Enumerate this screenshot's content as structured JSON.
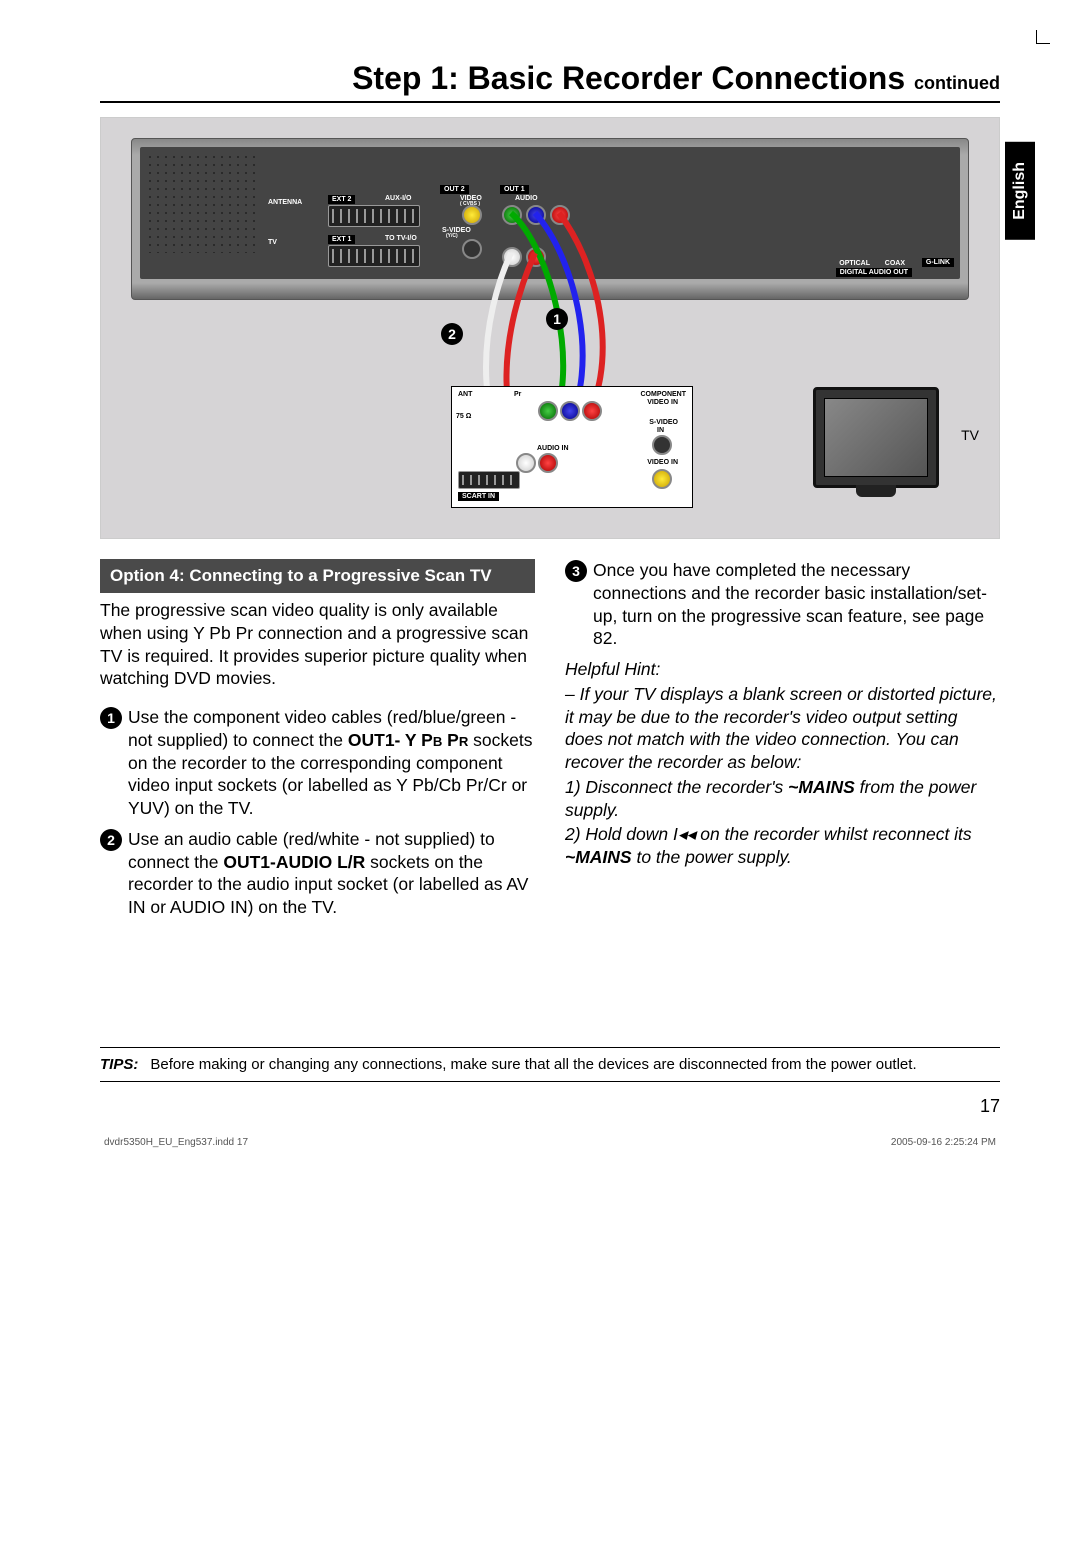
{
  "title_main": "Step 1: Basic Recorder Connections ",
  "title_cont": "continued",
  "lang_tab": "English",
  "diagram": {
    "tv_label": "TV",
    "callout_1": "1",
    "callout_2": "2",
    "recorder_labels": {
      "antenna": "ANTENNA",
      "tv": "TV",
      "ext2": "EXT 2",
      "ext1": "EXT 1",
      "aux": "AUX-I/O",
      "totv": "TO TV-I/O",
      "out2": "OUT 2",
      "out1": "OUT 1",
      "video": "VIDEO",
      "cvbs": "( CVBS )",
      "svideo": "S-VIDEO",
      "yc": "(Y/C)",
      "audio": "AUDIO",
      "optical": "OPTICAL",
      "coax": "COAX",
      "dao": "DIGITAL AUDIO OUT",
      "glink": "G-LINK"
    },
    "tv_labels": {
      "ant": "ANT",
      "75ohm": "75 Ω",
      "pr": "Pr",
      "component": "COMPONENT",
      "videoin": "VIDEO IN",
      "svideo": "S-VIDEO",
      "in": "IN",
      "audioin": "AUDIO IN",
      "videoin2": "VIDEO IN",
      "scartin": "SCART IN"
    }
  },
  "option_heading": "Option 4: Connecting to a Progressive Scan TV",
  "intro_para": "The progressive scan video quality is only available when using Y Pb Pr connection and a progressive scan TV is required. It provides superior picture quality when watching DVD movies.",
  "step1": {
    "num": "1",
    "pre": "Use the component video cables (red/blue/green - not supplied) to connect the ",
    "bold1": "OUT1- Y P",
    "sc1": "B",
    "bold2": " P",
    "sc2": "R",
    "post": " sockets on the recorder to the corresponding component video input sockets (or labelled as Y Pb/Cb Pr/Cr or YUV) on the TV."
  },
  "step2": {
    "num": "2",
    "pre": "Use an audio cable (red/white - not supplied) to connect the ",
    "bold": "OUT1-AUDIO L/R",
    "post": " sockets on the recorder to the audio input socket (or labelled as AV IN or AUDIO IN) on the TV."
  },
  "step3": {
    "num": "3",
    "text": "Once you have completed the necessary connections and the recorder basic installation/set-up, turn on the progressive scan feature, see page 82."
  },
  "hint_label": "Helpful Hint:",
  "hint1": "– If your TV displays a blank screen or distorted picture, it may be due to the recorder's video output setting does not match with the video connection. You can recover the recorder as below:",
  "hint2_pre": "1) Disconnect the recorder's ",
  "hint2_bold": "~MAINS",
  "hint2_post": " from the power supply.",
  "hint3_pre": "2) Hold down ",
  "hint3_icon": "I◂◂",
  "hint3_mid": " on the recorder whilst reconnect its ",
  "hint3_bold": "~MAINS",
  "hint3_post": " to the power supply.",
  "tips_label": "TIPS:",
  "tips_text": "Before making or changing any connections, make sure that all the devices are disconnected from the power outlet.",
  "page_num": "17",
  "footer_left": "dvdr5350H_EU_Eng537.indd   17",
  "footer_right": "2005-09-16   2:25:24 PM"
}
